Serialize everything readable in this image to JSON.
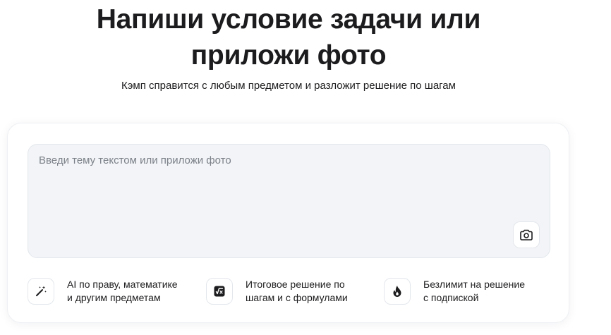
{
  "hero": {
    "title_line1": "Напиши условие задачи или",
    "title_line2": "приложи фото",
    "subtitle": "Кэмп справится с любым предметом и разложит решение по шагам"
  },
  "input": {
    "placeholder": "Введи тему текстом или приложи фото",
    "value": "",
    "attach_icon": "camera-icon"
  },
  "features": [
    {
      "icon": "magic-wand-icon",
      "line1": "AI по праву, математике",
      "line2": "и другим предметам"
    },
    {
      "icon": "square-root-icon",
      "line1": "Итоговое решение по",
      "line2": "шагам и с формулами"
    },
    {
      "icon": "flame-icon",
      "line1": "Безлимит на решение",
      "line2": "с подпиской"
    }
  ],
  "colors": {
    "text": "#1c1c1e",
    "placeholder": "#7c8189",
    "input_bg": "#f2f4f7",
    "border": "#e3e7ec"
  }
}
